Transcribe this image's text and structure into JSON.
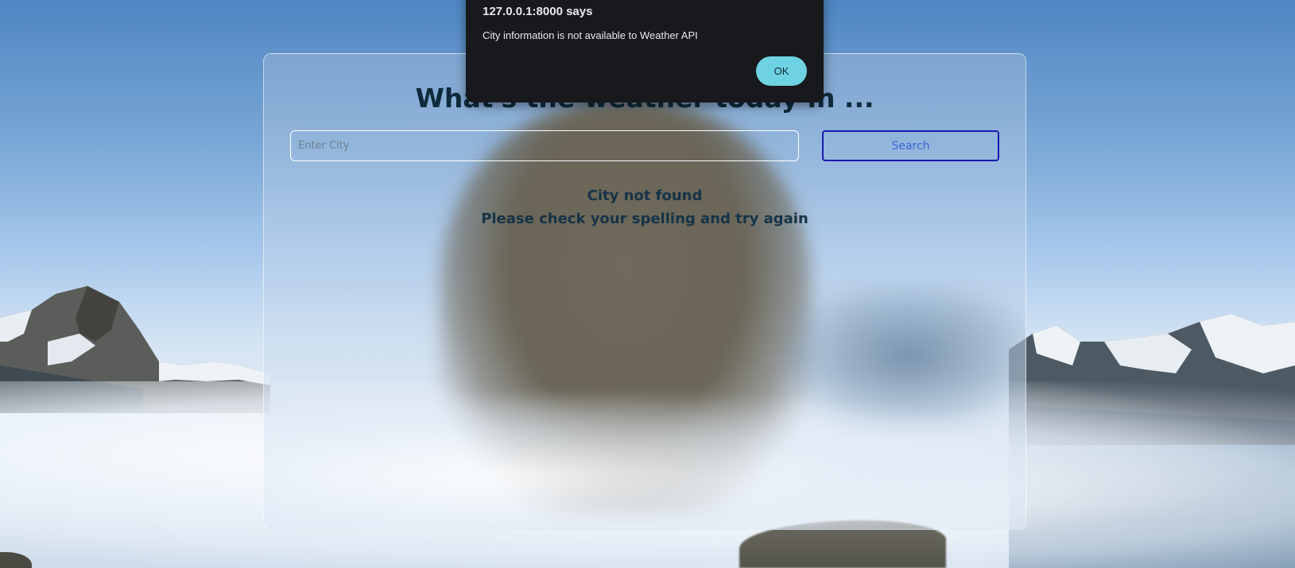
{
  "dialog": {
    "origin": "127.0.0.1:8000 says",
    "message": "City information is not available to Weather API",
    "ok_label": "OK"
  },
  "app": {
    "title": "What's the weather today in ...",
    "search_placeholder": "Enter City",
    "search_value": "",
    "search_button": "Search",
    "error_line1": "City not found",
    "error_line2": "Please check your spelling and try again"
  },
  "colors": {
    "dialog_bg": "#17191c",
    "ok_button": "#6fd2e2",
    "search_border": "#1a1ab0",
    "text_dark": "#0e2b3d"
  }
}
